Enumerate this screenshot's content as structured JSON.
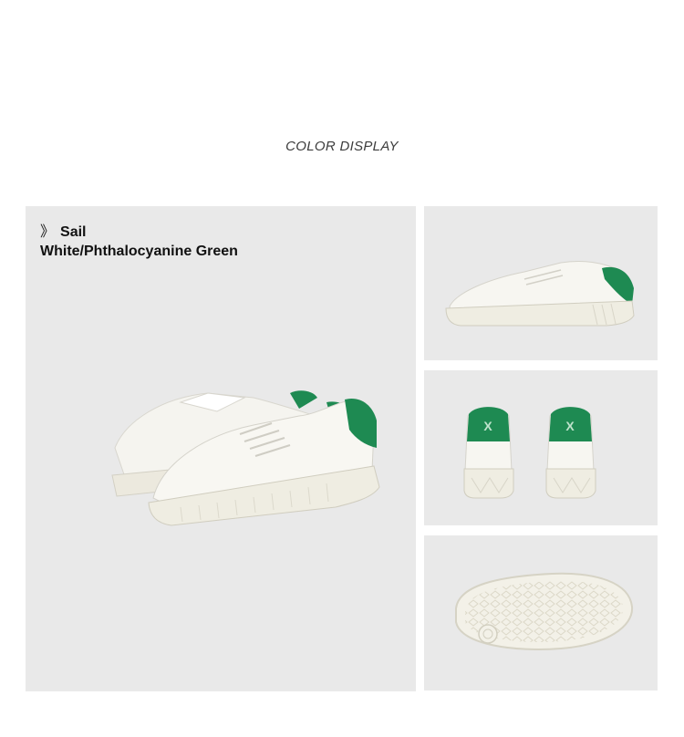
{
  "header": {
    "title": "COLOR DISPLAY"
  },
  "colorway": {
    "name": "Sail",
    "description": "White/Phthalocyanine Green",
    "bullet": "》"
  },
  "colors": {
    "panel_bg": "#e9e9e9",
    "shoe_upper": "#f7f6f1",
    "sole": "#efede3",
    "accent_green": "#1e8a52"
  },
  "gallery": {
    "images": [
      "pair-angle-view",
      "side-view",
      "rear-view",
      "outsole-view"
    ]
  }
}
